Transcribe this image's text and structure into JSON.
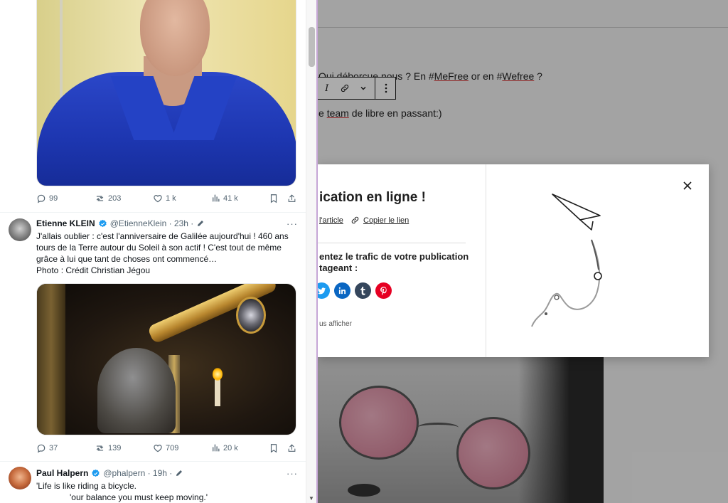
{
  "editor": {
    "line1_prefix": "Qui déborcue nous  ? En #",
    "line1_tag1": "MeFree",
    "line1_mid": " or en #",
    "line1_tag2": "Wefree",
    "line1_suffix": " ?",
    "line2_prefix": "e ",
    "line2_word": "team",
    "line2_suffix": " de libre en passant:)"
  },
  "toolbar": {
    "italic": "I",
    "link_icon": "link-icon",
    "more_icon": "chevron-down-icon",
    "options_icon": "more-vertical-icon"
  },
  "publish_modal": {
    "title": "ication en ligne !",
    "view_article": "l'article",
    "copy_link": "Copier le lien",
    "traffic_text": "entez le trafic de votre publication\ntageant :",
    "hide_text": "us afficher",
    "social": [
      {
        "name": "twitter",
        "color": "#1d9bf0"
      },
      {
        "name": "linkedin",
        "color": "#0a66c2"
      },
      {
        "name": "tumblr",
        "color": "#35465c"
      },
      {
        "name": "pinterest",
        "color": "#e60023"
      }
    ]
  },
  "tweets": [
    {
      "replies": "99",
      "retweets": "203",
      "likes": "1 k",
      "views": "41 k"
    },
    {
      "name": "Etienne KLEIN",
      "handle": "@EtienneKlein · 23h ·",
      "text": "J'allais oublier : c'est l'anniversaire de Galilée aujourd'hui ! 460 ans tours de la Terre autour du Soleil à son actif ! C'est tout de même grâce à lui que tant de choses ont commencé…",
      "photo_credit": "Photo : Crédit Christian Jégou",
      "replies": "37",
      "retweets": "139",
      "likes": "709",
      "views": "20 k"
    },
    {
      "name": "Paul Halpern",
      "handle": "@phalpern · 19h ·",
      "text_line1": "'Life is like riding a bicycle.",
      "text_line2": "'our balance you must keep moving.'"
    }
  ],
  "colors": {
    "verified": "#1d9bf0",
    "muted": "#536471",
    "panel_border": "#c6a6d6"
  }
}
